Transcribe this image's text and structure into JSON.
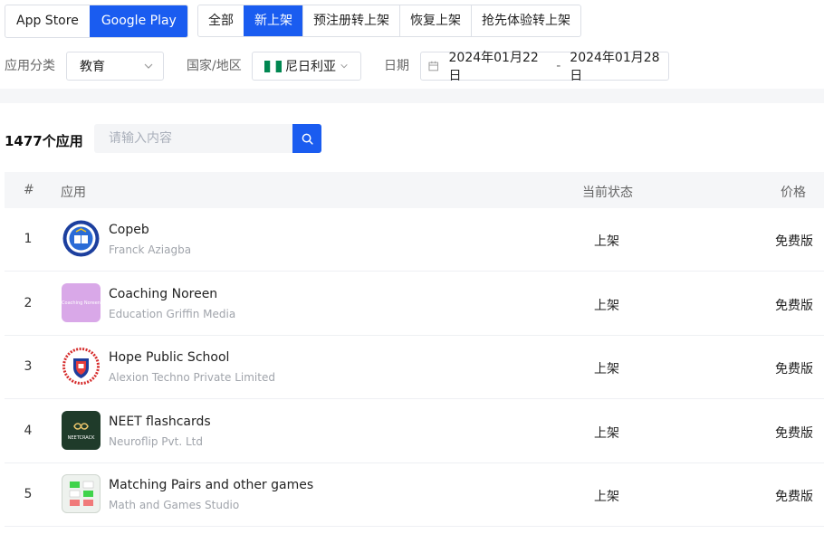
{
  "store_tabs": [
    {
      "label": "App Store",
      "active": false
    },
    {
      "label": "Google Play",
      "active": true
    }
  ],
  "status_tabs": [
    {
      "label": "全部",
      "active": false
    },
    {
      "label": "新上架",
      "active": true
    },
    {
      "label": "预注册转上架",
      "active": false
    },
    {
      "label": "恢复上架",
      "active": false
    },
    {
      "label": "抢先体验转上架",
      "active": false
    }
  ],
  "filters": {
    "category_label": "应用分类",
    "category_value": "教育",
    "country_label": "国家/地区",
    "country_value": "尼日利亚",
    "date_label": "日期",
    "date_start": "2024年01月22日",
    "date_sep": "-",
    "date_end": "2024年01月28日"
  },
  "results": {
    "count_text": "1477个应用",
    "search_placeholder": "请输入内容"
  },
  "table": {
    "headers": {
      "num": "#",
      "app": "应用",
      "state": "当前状态",
      "price": "价格"
    },
    "rows": [
      {
        "num": "1",
        "name": "Copeb",
        "developer": "Franck Aziagba",
        "state": "上架",
        "price": "免费版",
        "icon": "copeb-logo"
      },
      {
        "num": "2",
        "name": "Coaching Noreen",
        "developer": "Education Griffin Media",
        "state": "上架",
        "price": "免费版",
        "icon": "coaching-noreen-logo",
        "icon_text": "Coaching Noreen"
      },
      {
        "num": "3",
        "name": "Hope Public School",
        "developer": "Alexion Techno Private Limited",
        "state": "上架",
        "price": "免费版",
        "icon": "hope-school-crest"
      },
      {
        "num": "4",
        "name": "NEET flashcards",
        "developer": "Neuroflip Pvt. Ltd",
        "state": "上架",
        "price": "免费版",
        "icon": "neetcrack-logo",
        "icon_text": "NEETCRACK"
      },
      {
        "num": "5",
        "name": "Matching Pairs and other games",
        "developer": "Math and Games Studio",
        "state": "上架",
        "price": "免费版",
        "icon": "matching-pairs-logo"
      }
    ]
  },
  "colors": {
    "accent": "#1a5cf0",
    "nigeria_green": "#008751"
  }
}
